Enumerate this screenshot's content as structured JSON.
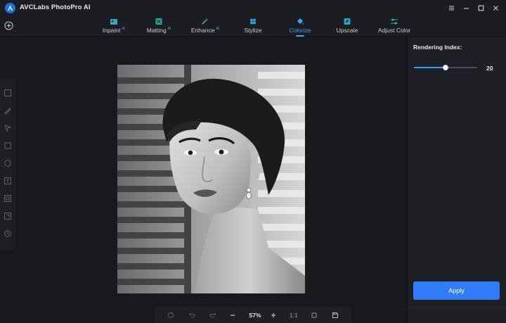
{
  "app": {
    "title": "AVCLabs PhotoPro AI",
    "logo_icon": "avclabs-logo-icon"
  },
  "window_controls": [
    "menu-icon",
    "minimize-icon",
    "maximize-icon",
    "close-icon"
  ],
  "tabs": [
    {
      "label": "Inpaint",
      "ai": "AI",
      "icon": "inpaint-icon",
      "active": false
    },
    {
      "label": "Matting",
      "ai": "AI",
      "icon": "matting-icon",
      "active": false
    },
    {
      "label": "Enhance",
      "ai": "AI",
      "icon": "enhance-icon",
      "active": false
    },
    {
      "label": "Stylize",
      "ai": "",
      "icon": "stylize-icon",
      "active": false
    },
    {
      "label": "Colorize",
      "ai": "",
      "icon": "colorize-icon",
      "active": true
    },
    {
      "label": "Upscale",
      "ai": "",
      "icon": "upscale-icon",
      "active": false
    },
    {
      "label": "Adjust Color",
      "ai": "",
      "icon": "adjust-color-icon",
      "active": false
    }
  ],
  "toolbar": {
    "zoom": "57%",
    "ratio": "1:1",
    "icons": [
      "reset-icon",
      "undo-icon",
      "redo-icon",
      "zoom-out-icon",
      "zoom-in-icon",
      "fit-icon",
      "save-icon"
    ]
  },
  "left_tools": [
    "select-icon",
    "brush-icon",
    "lasso-icon",
    "rectangle-icon",
    "ellipse-icon",
    "text-icon",
    "copy-icon",
    "crop-icon",
    "history-icon"
  ],
  "panel": {
    "rendering_label": "Rendering Index:",
    "rendering_value": "20",
    "slider_fraction": 0.5,
    "apply_label": "Apply"
  },
  "colors": {
    "accent": "#3fa3ff",
    "apply": "#2f7cf6",
    "background": "#16181c"
  }
}
